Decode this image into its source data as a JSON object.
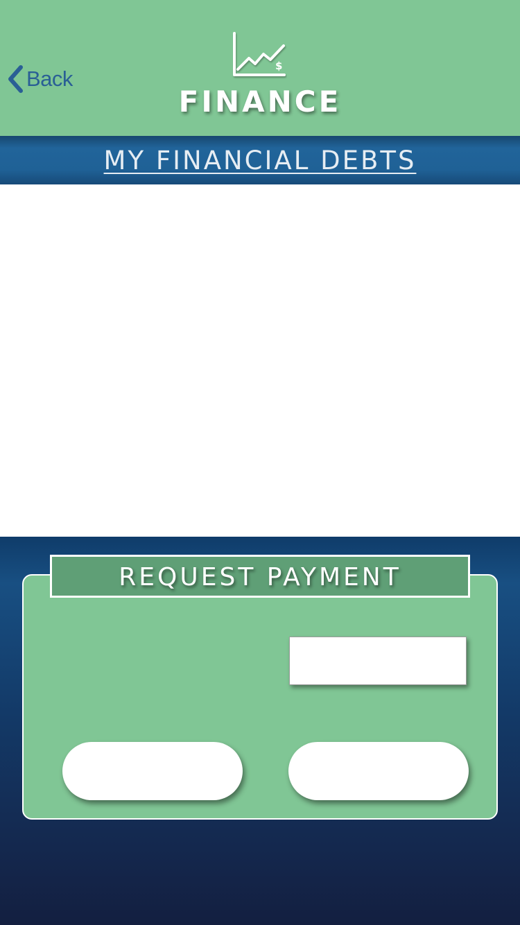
{
  "header": {
    "back_label": "Back",
    "title": "FINANCE",
    "icon": "finance-chart-icon",
    "background_color": "#80c695"
  },
  "section": {
    "title": "MY FINANCIAL DEBTS",
    "background_color": "#1f6196"
  },
  "debts": {
    "items": []
  },
  "request_payment": {
    "title": "REQUEST PAYMENT",
    "amount_value": "",
    "left_button_label": "",
    "right_button_label": "",
    "card_color": "#80c695",
    "title_bar_color": "#5f9f76"
  }
}
